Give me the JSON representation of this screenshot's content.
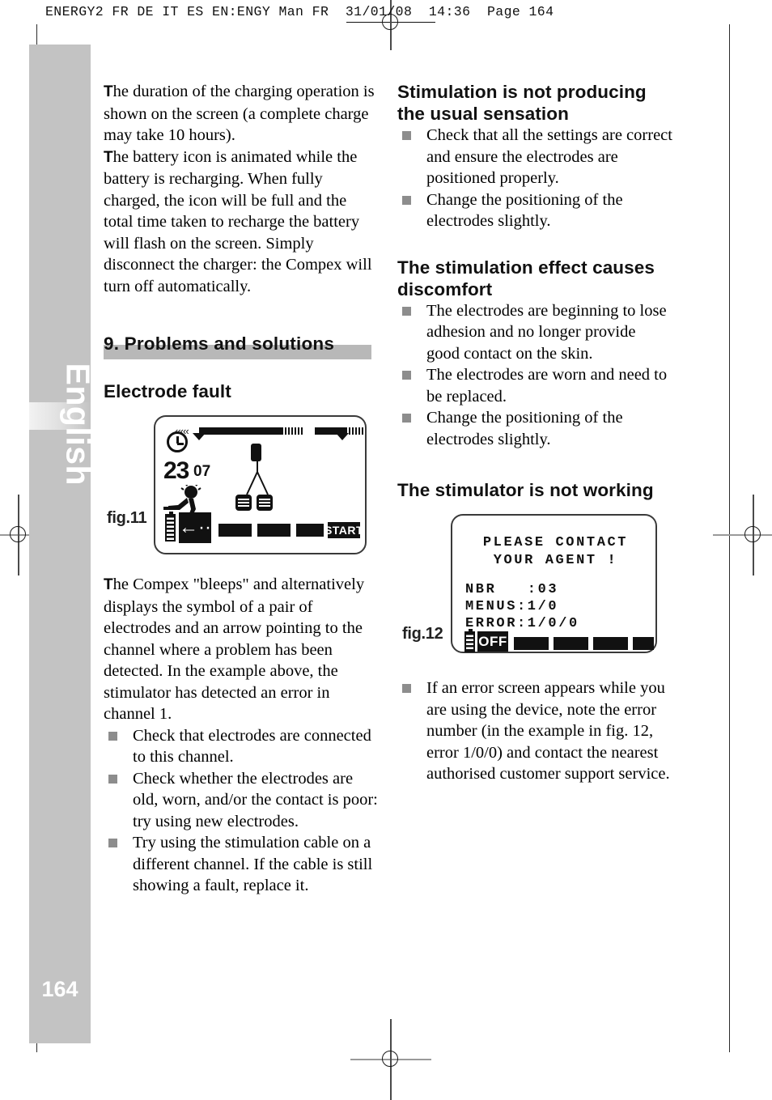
{
  "header": {
    "text": "ENERGY2 FR DE IT ES EN:ENGY Man FR  31/01/08  14:36  Page 164"
  },
  "sidebar": {
    "language": "English",
    "page_number": "164"
  },
  "left_column": {
    "paragraph_1": "he duration of the charging operation is shown on the screen (a complete charge may take 10 hours).",
    "paragraph_1_cap": "T",
    "paragraph_2": "he battery icon is animated while the battery is recharging. When fully charged, the icon will be full and the total time taken to recharge the battery will flash on the screen. Simply disconnect the charger: the Compex will turn off automatically.",
    "paragraph_2_cap": "T",
    "section_heading": "9. Problems and solutions",
    "subheading_1": "Electrode fault",
    "paragraph_3_cap": "T",
    "paragraph_3": "he Compex \"bleeps\" and alternatively displays the symbol of a pair of electrodes and an arrow pointing to the channel where a problem has been detected. In the example above, the stimulator has detected an error in channel 1.",
    "bullets": [
      "Check that electrodes are connected to this channel.",
      "Check whether the electrodes are old, worn, and/or the contact is poor: try using new electrodes.",
      "Try using the stimulation cable on a different channel. If the cable is still showing a fault, replace it."
    ]
  },
  "right_column": {
    "subheading_1": "Stimulation is not producing the usual sensation",
    "bullets_1": [
      "Check that all the settings are correct and ensure the electrodes are positioned properly.",
      "Change the positioning of the electrodes slightly."
    ],
    "subheading_2": "The stimulation effect causes discomfort",
    "bullets_2": [
      "The electrodes are beginning to lose adhesion and no longer provide good contact on the skin.",
      "The electrodes are worn and need to be replaced.",
      "Change the positioning of the electrodes slightly."
    ],
    "subheading_3": "The stimulator is not working",
    "bullets_3": [
      "If an error screen appears while you are using the device, note the error number (in the example in fig. 12, error 1/0/0) and contact the nearest authorised customer support service."
    ]
  },
  "figure_11": {
    "label": "fig.11",
    "screen": {
      "time_major": "23",
      "time_minor": "07",
      "start_button": "START",
      "chevrons": "‹‹‹‹‹",
      "icons": [
        "clock-icon",
        "athlete-icon",
        "electrode-pair-icon",
        "battery-icon",
        "left-arrow-icon"
      ],
      "soft_keys": [
        "",
        "",
        "",
        "START"
      ]
    }
  },
  "figure_12": {
    "label": "fig.12",
    "screen": {
      "line_1": "PLEASE CONTACT",
      "line_2": "YOUR AGENT !",
      "line_3": "NBR   :03",
      "line_4": "MENUS:1/0",
      "line_5": "ERROR:1/0/0",
      "off_button": "OFF",
      "soft_keys": [
        "OFF",
        "",
        "",
        "",
        ""
      ]
    }
  },
  "colors": {
    "sidebar_grey": "#c3c3c3",
    "section_bar_grey": "#b8b8b8",
    "bullet_grey": "#8d8d8d",
    "text_black": "#111111"
  }
}
